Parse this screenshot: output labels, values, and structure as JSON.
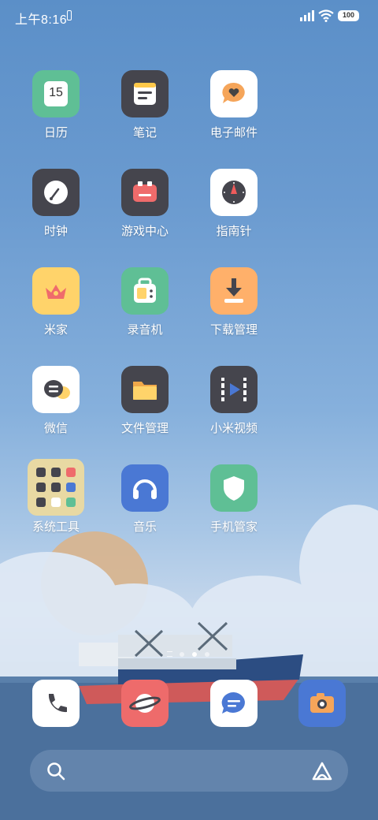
{
  "status_bar": {
    "time": "上午8:16",
    "battery": "100"
  },
  "colors": {
    "calendar": "#5fbf95",
    "notes": "#45454d",
    "email": "#ffffff",
    "clock": "#45454d",
    "game": "#45454d",
    "compass": "#ffffff",
    "mijia": "#ffd36a",
    "recorder": "#5fbf95",
    "downloads": "#ffb06a",
    "wechat": "#ffffff",
    "files": "#45454d",
    "video": "#45454d",
    "tools": "#e8d9a3",
    "music": "#4a78d4",
    "security": "#5fbf95",
    "phone": "#ffffff",
    "browser": "#ee6b6b",
    "messages": "#ffffff",
    "camera": "#4a78d4"
  },
  "apps": [
    {
      "label": "日历",
      "icon": "calendar-icon",
      "text": "15"
    },
    {
      "label": "笔记",
      "icon": "notes-icon"
    },
    {
      "label": "电子邮件",
      "icon": "email-icon"
    },
    {
      "label": "时钟",
      "icon": "clock-icon"
    },
    {
      "label": "游戏中心",
      "icon": "game-center-icon"
    },
    {
      "label": "指南针",
      "icon": "compass-icon"
    },
    {
      "label": "米家",
      "icon": "mijia-icon"
    },
    {
      "label": "录音机",
      "icon": "recorder-icon"
    },
    {
      "label": "下载管理",
      "icon": "downloads-icon"
    },
    {
      "label": "微信",
      "icon": "wechat-icon"
    },
    {
      "label": "文件管理",
      "icon": "files-icon"
    },
    {
      "label": "小米视频",
      "icon": "video-icon"
    },
    {
      "label": "系统工具",
      "icon": "tools-folder-icon"
    },
    {
      "label": "音乐",
      "icon": "music-icon"
    },
    {
      "label": "手机管家",
      "icon": "security-icon"
    }
  ],
  "dock": [
    {
      "icon": "phone-icon"
    },
    {
      "icon": "browser-icon"
    },
    {
      "icon": "messages-icon"
    },
    {
      "icon": "camera-icon"
    }
  ],
  "page_indicator": {
    "pages": 3,
    "current": 1
  }
}
